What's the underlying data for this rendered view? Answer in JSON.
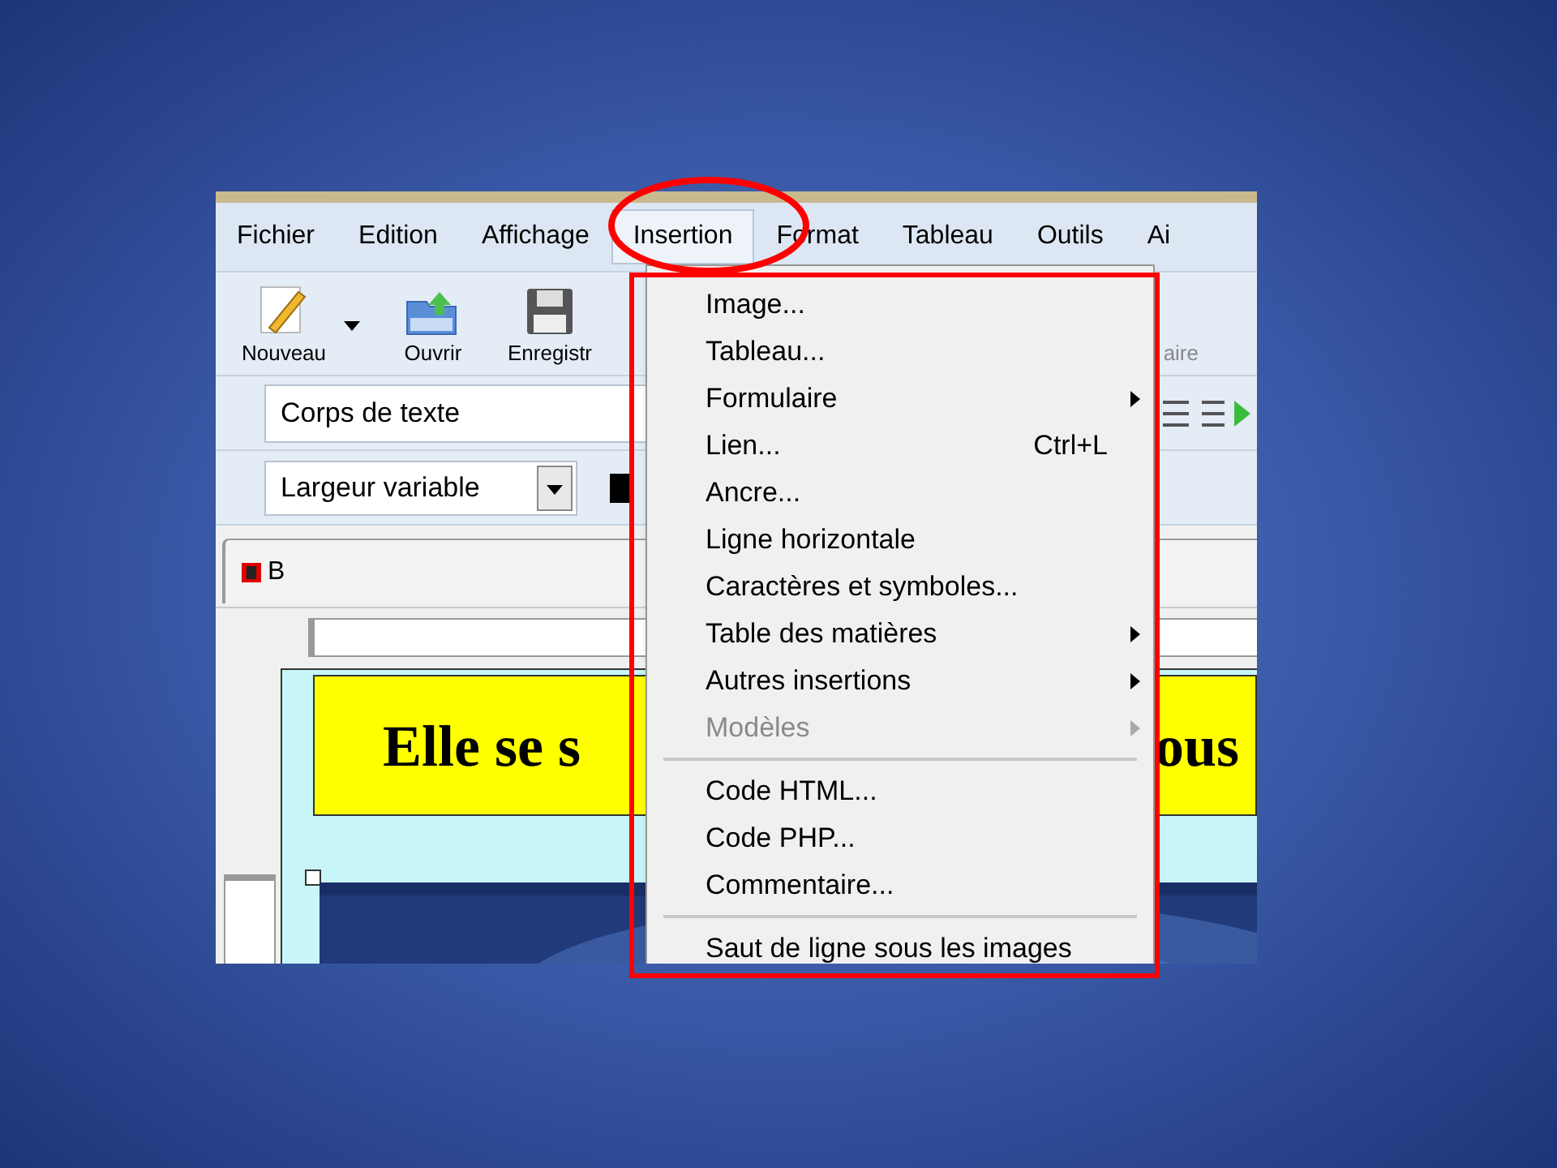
{
  "menu_bar": [
    {
      "label": "Fichier",
      "selected": false
    },
    {
      "label": "Edition",
      "selected": false
    },
    {
      "label": "Affichage",
      "selected": false
    },
    {
      "label": "Insertion",
      "selected": true
    },
    {
      "label": "Format",
      "selected": false
    },
    {
      "label": "Tableau",
      "selected": false
    },
    {
      "label": "Outils",
      "selected": false
    },
    {
      "label": "Ai",
      "selected": false
    }
  ],
  "toolbar": [
    {
      "label": "Nouveau",
      "kind": "new"
    },
    {
      "label": "Ouvrir",
      "kind": "open"
    },
    {
      "label": "Enregistr",
      "kind": "save"
    },
    {
      "label": "aire",
      "kind": "partial"
    }
  ],
  "paragraph_style": {
    "value": "Corps de texte"
  },
  "font_select": {
    "value": "Largeur variable"
  },
  "document_tab": {
    "label": "B"
  },
  "heading": {
    "left": "Elle se s",
    "right": "ous"
  },
  "insert_menu": [
    {
      "kind": "item",
      "label": "Image...",
      "disabled": false
    },
    {
      "kind": "item",
      "label": "Tableau...",
      "disabled": false
    },
    {
      "kind": "item",
      "label": "Formulaire",
      "submenu": true,
      "disabled": false
    },
    {
      "kind": "item",
      "label": "Lien...",
      "shortcut": "Ctrl+L",
      "disabled": false
    },
    {
      "kind": "item",
      "label": "Ancre...",
      "disabled": false
    },
    {
      "kind": "item",
      "label": "Ligne horizontale",
      "disabled": false
    },
    {
      "kind": "item",
      "label": "Caractères et symboles...",
      "disabled": false
    },
    {
      "kind": "item",
      "label": "Table des matières",
      "submenu": true,
      "disabled": false
    },
    {
      "kind": "item",
      "label": "Autres insertions",
      "submenu": true,
      "disabled": false
    },
    {
      "kind": "item",
      "label": "Modèles",
      "submenu": true,
      "disabled": true
    },
    {
      "kind": "separator"
    },
    {
      "kind": "item",
      "label": "Code HTML...",
      "disabled": false
    },
    {
      "kind": "item",
      "label": "Code PHP...",
      "disabled": false
    },
    {
      "kind": "item",
      "label": "Commentaire...",
      "disabled": false
    },
    {
      "kind": "separator"
    },
    {
      "kind": "item",
      "label": "Saut de ligne sous les images",
      "disabled": false
    }
  ]
}
